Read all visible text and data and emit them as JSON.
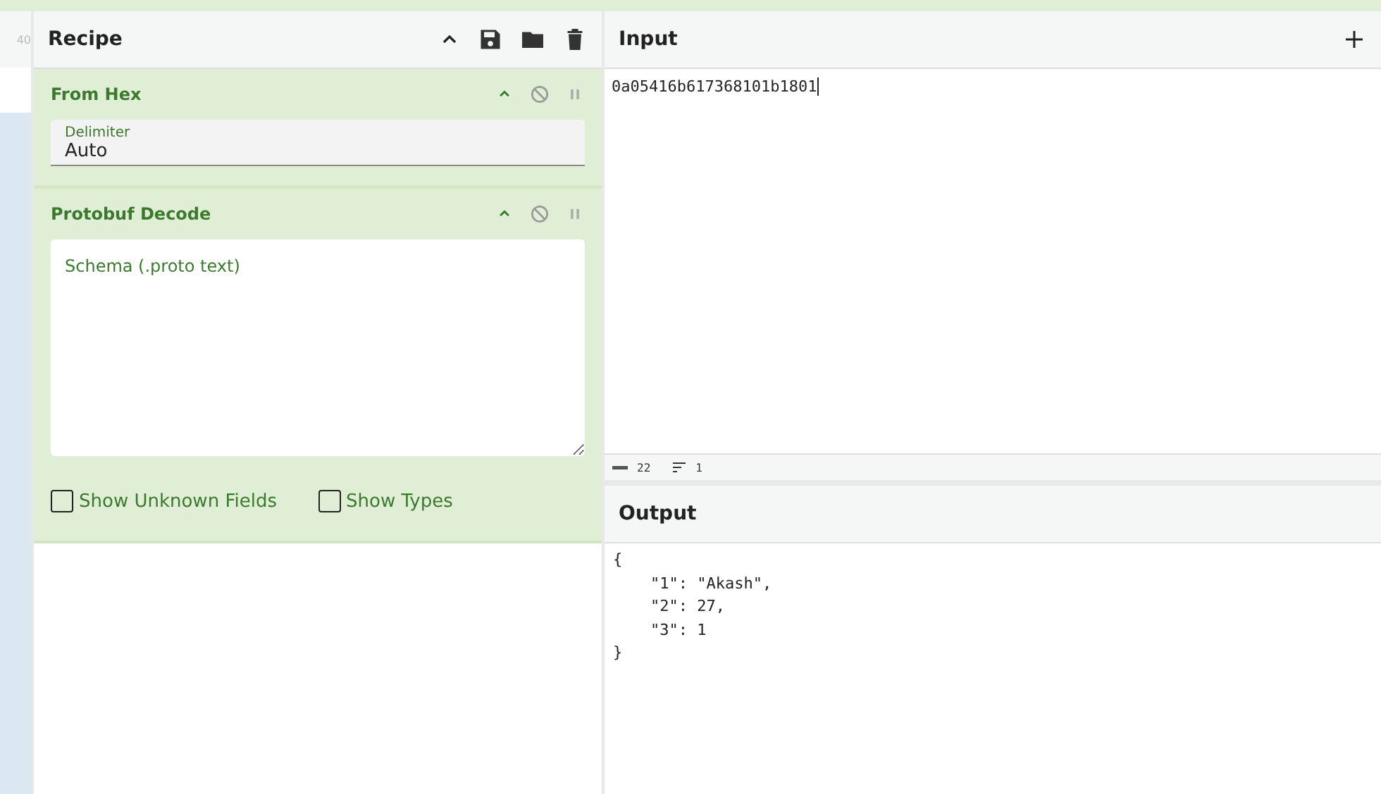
{
  "left_strip": {
    "label": "40"
  },
  "recipe": {
    "title": "Recipe",
    "operations": [
      {
        "title": "From Hex",
        "args": [
          {
            "kind": "field",
            "label": "Delimiter",
            "value": "Auto"
          }
        ]
      },
      {
        "title": "Protobuf Decode",
        "args": [
          {
            "kind": "textarea",
            "placeholder": "Schema (.proto text)"
          },
          {
            "kind": "checkbox",
            "label": "Show Unknown Fields",
            "checked": false
          },
          {
            "kind": "checkbox",
            "label": "Show Types",
            "checked": false
          }
        ]
      }
    ]
  },
  "input": {
    "title": "Input",
    "value": "0a05416b617368101b1801",
    "status": {
      "chars": "22",
      "lines": "1"
    }
  },
  "output": {
    "title": "Output",
    "lines": [
      "{",
      "    \"1\": \"Akash\",",
      "    \"2\": 27,",
      "    \"3\": 1",
      "}"
    ]
  }
}
